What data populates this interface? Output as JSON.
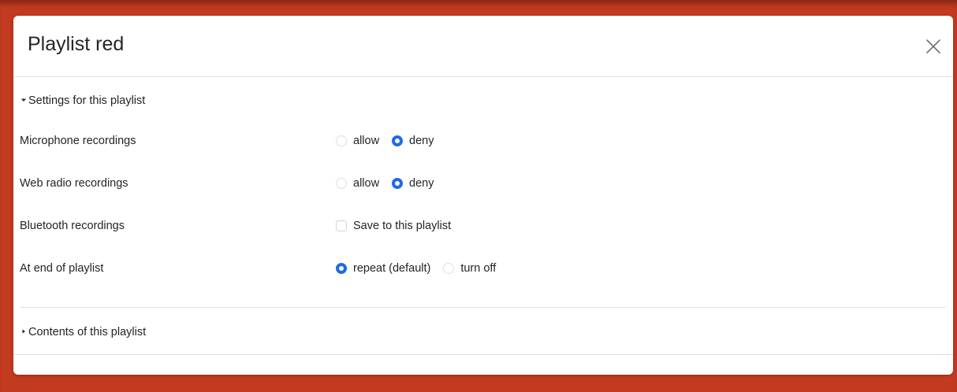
{
  "modal": {
    "title": "Playlist red",
    "close_icon": "close-icon"
  },
  "settings_section": {
    "label": "Settings for this playlist",
    "expanded": true
  },
  "rows": {
    "microphone": {
      "label": "Microphone recordings",
      "options": [
        {
          "label": "allow",
          "checked": false
        },
        {
          "label": "deny",
          "checked": true
        }
      ]
    },
    "web_radio": {
      "label": "Web radio recordings",
      "options": [
        {
          "label": "allow",
          "checked": false
        },
        {
          "label": "deny",
          "checked": true
        }
      ]
    },
    "bluetooth": {
      "label": "Bluetooth recordings",
      "checkbox_label": "Save to this playlist",
      "checked": false
    },
    "end_of_playlist": {
      "label": "At end of playlist",
      "options": [
        {
          "label": "repeat (default)",
          "checked": true
        },
        {
          "label": "turn off",
          "checked": false
        }
      ]
    }
  },
  "contents_section": {
    "label": "Contents of this playlist",
    "expanded": false
  },
  "colors": {
    "backdrop": "#c23a1f",
    "accent": "#1e6be6",
    "text": "#212529",
    "divider": "#dee2e6"
  }
}
